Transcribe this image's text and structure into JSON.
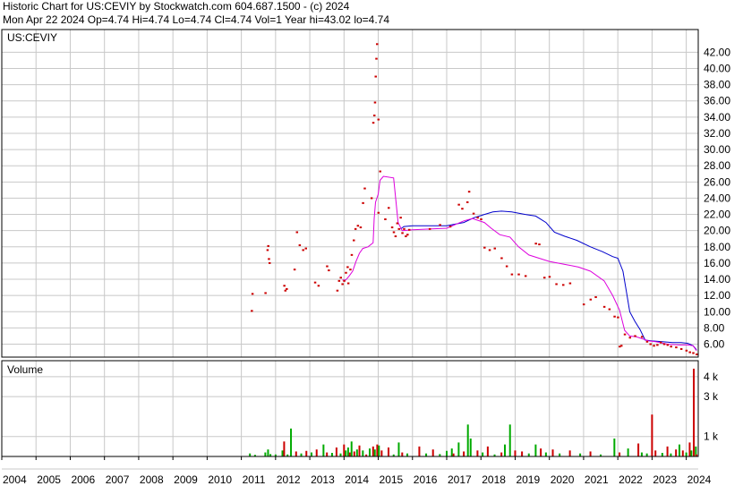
{
  "header": {
    "line1": "Historic Chart for US:CEVIY by Stockwatch.com 604.687.1500 - (c) 2024",
    "line2": "Mon Apr 22 2024  Op=4.74  Hi=4.74  Lo=4.74  Cl=4.74  Vol=1  Year hi=43.02  lo=4.74"
  },
  "price_panel": {
    "label": "US:CEVIY"
  },
  "volume_panel": {
    "label": "Volume"
  },
  "chart_data": [
    {
      "type": "scatter",
      "title": "US:CEVIY",
      "y_ticks": [
        "42.00",
        "40.00",
        "38.00",
        "36.00",
        "34.00",
        "32.00",
        "30.00",
        "28.00",
        "26.00",
        "24.00",
        "22.00",
        "20.00",
        "18.00",
        "16.00",
        "14.00",
        "12.00",
        "10.00",
        "8.00",
        "6.00"
      ],
      "ylim": [
        4.4,
        44.8
      ],
      "xlim": [
        2004.0,
        2024.35
      ],
      "x_ticks": [
        "2004",
        "2005",
        "2006",
        "2007",
        "2008",
        "2009",
        "2010",
        "2011",
        "2012",
        "2013",
        "2014",
        "2015",
        "2016",
        "2017",
        "2018",
        "2019",
        "2020",
        "2021",
        "2022",
        "2023",
        "2024"
      ],
      "grid": true,
      "colors": {
        "price": "#cc0000",
        "ma_short": "#dd00dd",
        "ma_long": "#0000cc",
        "grid": "#c8c8c8"
      },
      "price_points": [
        [
          2011.3,
          10.1
        ],
        [
          2011.32,
          12.2
        ],
        [
          2011.7,
          12.3
        ],
        [
          2011.76,
          17.6
        ],
        [
          2011.78,
          18.1
        ],
        [
          2011.8,
          16.5
        ],
        [
          2011.82,
          16.0
        ],
        [
          2012.25,
          13.2
        ],
        [
          2012.28,
          12.6
        ],
        [
          2012.32,
          12.8
        ],
        [
          2012.55,
          15.2
        ],
        [
          2012.62,
          19.8
        ],
        [
          2012.7,
          18.2
        ],
        [
          2012.8,
          17.6
        ],
        [
          2012.88,
          17.8
        ],
        [
          2013.15,
          13.6
        ],
        [
          2013.25,
          13.2
        ],
        [
          2013.5,
          15.6
        ],
        [
          2013.55,
          15.1
        ],
        [
          2013.8,
          12.6
        ],
        [
          2013.85,
          13.8
        ],
        [
          2013.9,
          14.2
        ],
        [
          2013.95,
          13.4
        ],
        [
          2014.0,
          13.8
        ],
        [
          2014.05,
          14.8
        ],
        [
          2014.1,
          15.5
        ],
        [
          2014.12,
          13.5
        ],
        [
          2014.18,
          15.2
        ],
        [
          2014.22,
          17.0
        ],
        [
          2014.28,
          18.8
        ],
        [
          2014.33,
          20.2
        ],
        [
          2014.4,
          20.6
        ],
        [
          2014.48,
          20.4
        ],
        [
          2014.55,
          23.4
        ],
        [
          2014.6,
          25.2
        ],
        [
          2014.8,
          24.0
        ],
        [
          2014.85,
          33.3
        ],
        [
          2014.88,
          34.2
        ],
        [
          2014.9,
          35.8
        ],
        [
          2014.92,
          39.0
        ],
        [
          2014.94,
          41.2
        ],
        [
          2014.96,
          43.0
        ],
        [
          2015.0,
          33.7
        ],
        [
          2015.05,
          27.3
        ],
        [
          2015.0,
          22.2
        ],
        [
          2015.2,
          21.4
        ],
        [
          2015.3,
          22.8
        ],
        [
          2015.4,
          20.4
        ],
        [
          2015.45,
          19.8
        ],
        [
          2015.5,
          19.3
        ],
        [
          2015.55,
          20.9
        ],
        [
          2015.6,
          20.2
        ],
        [
          2015.65,
          21.6
        ],
        [
          2015.7,
          19.7
        ],
        [
          2015.75,
          20.2
        ],
        [
          2015.8,
          19.3
        ],
        [
          2015.85,
          19.5
        ],
        [
          2015.9,
          20.1
        ],
        [
          2016.5,
          20.2
        ],
        [
          2016.8,
          20.7
        ],
        [
          2017.1,
          20.5
        ],
        [
          2017.35,
          23.2
        ],
        [
          2017.45,
          22.7
        ],
        [
          2017.6,
          23.5
        ],
        [
          2017.65,
          24.8
        ],
        [
          2017.78,
          22.1
        ],
        [
          2017.9,
          21.6
        ],
        [
          2018.0,
          21.4
        ],
        [
          2018.1,
          17.9
        ],
        [
          2018.25,
          17.6
        ],
        [
          2018.4,
          17.8
        ],
        [
          2018.6,
          16.6
        ],
        [
          2018.75,
          15.6
        ],
        [
          2018.9,
          14.6
        ],
        [
          2019.1,
          14.6
        ],
        [
          2019.3,
          14.4
        ],
        [
          2019.6,
          18.4
        ],
        [
          2019.7,
          18.3
        ],
        [
          2019.85,
          14.2
        ],
        [
          2020.0,
          14.3
        ],
        [
          2020.2,
          13.4
        ],
        [
          2020.4,
          13.3
        ],
        [
          2020.6,
          13.5
        ],
        [
          2021.0,
          10.9
        ],
        [
          2021.2,
          11.5
        ],
        [
          2021.35,
          11.8
        ],
        [
          2021.6,
          10.6
        ],
        [
          2021.75,
          10.3
        ],
        [
          2021.9,
          9.4
        ],
        [
          2022.0,
          9.3
        ],
        [
          2022.05,
          5.7
        ],
        [
          2022.1,
          5.8
        ],
        [
          2022.2,
          7.2
        ],
        [
          2022.35,
          6.8
        ],
        [
          2022.5,
          7.0
        ],
        [
          2022.7,
          6.9
        ],
        [
          2022.85,
          6.3
        ],
        [
          2022.95,
          6.0
        ],
        [
          2023.05,
          5.8
        ],
        [
          2023.15,
          5.9
        ],
        [
          2023.25,
          6.2
        ],
        [
          2023.35,
          6.0
        ],
        [
          2023.45,
          5.9
        ],
        [
          2023.55,
          5.7
        ],
        [
          2023.7,
          5.6
        ],
        [
          2023.85,
          5.4
        ],
        [
          2024.0,
          5.2
        ],
        [
          2024.1,
          5.0
        ],
        [
          2024.2,
          4.9
        ],
        [
          2024.3,
          4.74
        ]
      ],
      "ma_short": [
        [
          2013.95,
          13.9
        ],
        [
          2014.05,
          13.9
        ],
        [
          2014.15,
          14.4
        ],
        [
          2014.25,
          15.0
        ],
        [
          2014.35,
          16.2
        ],
        [
          2014.45,
          17.2
        ],
        [
          2014.55,
          17.8
        ],
        [
          2014.7,
          18.0
        ],
        [
          2014.85,
          18.5
        ],
        [
          2014.88,
          21.5
        ],
        [
          2014.92,
          23.5
        ],
        [
          2015.0,
          24.5
        ],
        [
          2015.05,
          26.2
        ],
        [
          2015.15,
          26.7
        ],
        [
          2015.45,
          26.5
        ],
        [
          2015.58,
          21.0
        ],
        [
          2015.7,
          20.0
        ],
        [
          2016.0,
          20.1
        ],
        [
          2016.5,
          20.2
        ],
        [
          2017.0,
          20.3
        ],
        [
          2017.5,
          21.2
        ],
        [
          2017.75,
          21.5
        ],
        [
          2018.1,
          21.0
        ],
        [
          2018.3,
          20.3
        ],
        [
          2018.55,
          19.5
        ],
        [
          2018.85,
          19.2
        ],
        [
          2019.1,
          18.0
        ],
        [
          2019.4,
          17.0
        ],
        [
          2019.7,
          16.6
        ],
        [
          2020.0,
          16.2
        ],
        [
          2020.5,
          15.8
        ],
        [
          2020.85,
          15.5
        ],
        [
          2021.2,
          15.0
        ],
        [
          2021.6,
          13.8
        ],
        [
          2021.85,
          12.0
        ],
        [
          2022.05,
          10.2
        ],
        [
          2022.2,
          7.7
        ],
        [
          2022.35,
          7.0
        ],
        [
          2022.55,
          6.9
        ],
        [
          2022.9,
          6.4
        ],
        [
          2023.1,
          6.3
        ],
        [
          2023.45,
          6.0
        ],
        [
          2023.8,
          5.9
        ],
        [
          2024.05,
          5.9
        ],
        [
          2024.2,
          5.8
        ],
        [
          2024.3,
          5.2
        ]
      ],
      "ma_long": [
        [
          2015.65,
          20.2
        ],
        [
          2015.75,
          20.5
        ],
        [
          2016.0,
          20.6
        ],
        [
          2016.5,
          20.6
        ],
        [
          2017.0,
          20.6
        ],
        [
          2017.5,
          21.0
        ],
        [
          2017.8,
          21.6
        ],
        [
          2018.1,
          22.0
        ],
        [
          2018.35,
          22.3
        ],
        [
          2018.6,
          22.4
        ],
        [
          2018.9,
          22.3
        ],
        [
          2019.3,
          22.0
        ],
        [
          2019.6,
          21.8
        ],
        [
          2019.9,
          21.0
        ],
        [
          2020.15,
          19.8
        ],
        [
          2020.45,
          19.3
        ],
        [
          2020.8,
          18.8
        ],
        [
          2021.2,
          18.0
        ],
        [
          2021.55,
          17.4
        ],
        [
          2021.85,
          16.8
        ],
        [
          2022.0,
          16.6
        ],
        [
          2022.15,
          15.0
        ],
        [
          2022.25,
          12.5
        ],
        [
          2022.35,
          10.0
        ],
        [
          2022.5,
          8.8
        ],
        [
          2022.65,
          7.8
        ],
        [
          2022.8,
          6.5
        ],
        [
          2023.0,
          6.4
        ],
        [
          2023.3,
          6.3
        ],
        [
          2023.6,
          6.2
        ],
        [
          2023.85,
          6.2
        ],
        [
          2024.05,
          6.1
        ],
        [
          2024.2,
          5.8
        ],
        [
          2024.3,
          5.3
        ]
      ]
    },
    {
      "type": "bar",
      "title": "Volume",
      "y_ticks": [
        "4 k",
        "3 k",
        "1 k"
      ],
      "ylim": [
        0,
        4800
      ],
      "xlim": [
        2004.0,
        2024.35
      ],
      "colors": {
        "up": "#00aa00",
        "down": "#cc0000"
      },
      "bars": [
        [
          2011.25,
          150,
          "up"
        ],
        [
          2011.4,
          80,
          "up"
        ],
        [
          2011.7,
          200,
          "up"
        ],
        [
          2011.78,
          350,
          "up"
        ],
        [
          2011.85,
          120,
          "up"
        ],
        [
          2012.0,
          100,
          "up"
        ],
        [
          2012.2,
          300,
          "up"
        ],
        [
          2012.25,
          750,
          "down"
        ],
        [
          2012.35,
          100,
          "up"
        ],
        [
          2012.45,
          1400,
          "up"
        ],
        [
          2012.6,
          250,
          "down"
        ],
        [
          2012.75,
          150,
          "up"
        ],
        [
          2012.9,
          280,
          "down"
        ],
        [
          2013.05,
          200,
          "up"
        ],
        [
          2013.2,
          350,
          "down"
        ],
        [
          2013.4,
          600,
          "up"
        ],
        [
          2013.5,
          200,
          "down"
        ],
        [
          2013.65,
          180,
          "up"
        ],
        [
          2013.78,
          450,
          "down"
        ],
        [
          2013.9,
          150,
          "up"
        ],
        [
          2014.0,
          600,
          "down"
        ],
        [
          2014.05,
          300,
          "up"
        ],
        [
          2014.12,
          450,
          "up"
        ],
        [
          2014.17,
          200,
          "down"
        ],
        [
          2014.22,
          750,
          "up"
        ],
        [
          2014.3,
          250,
          "down"
        ],
        [
          2014.38,
          350,
          "up"
        ],
        [
          2014.45,
          550,
          "down"
        ],
        [
          2014.55,
          300,
          "up"
        ],
        [
          2014.65,
          100,
          "down"
        ],
        [
          2014.75,
          400,
          "up"
        ],
        [
          2014.85,
          500,
          "down"
        ],
        [
          2014.9,
          350,
          "up"
        ],
        [
          2014.97,
          600,
          "down"
        ],
        [
          2015.02,
          550,
          "up"
        ],
        [
          2015.1,
          300,
          "down"
        ],
        [
          2015.3,
          450,
          "down"
        ],
        [
          2015.45,
          100,
          "up"
        ],
        [
          2015.6,
          700,
          "up"
        ],
        [
          2015.7,
          200,
          "down"
        ],
        [
          2015.85,
          150,
          "up"
        ],
        [
          2016.2,
          500,
          "down"
        ],
        [
          2016.4,
          150,
          "up"
        ],
        [
          2016.6,
          350,
          "down"
        ],
        [
          2016.8,
          120,
          "up"
        ],
        [
          2017.0,
          280,
          "up"
        ],
        [
          2017.15,
          400,
          "up"
        ],
        [
          2017.2,
          150,
          "down"
        ],
        [
          2017.35,
          700,
          "up"
        ],
        [
          2017.5,
          250,
          "down"
        ],
        [
          2017.62,
          1600,
          "up"
        ],
        [
          2017.7,
          900,
          "up"
        ],
        [
          2017.9,
          300,
          "down"
        ],
        [
          2018.05,
          200,
          "up"
        ],
        [
          2018.2,
          500,
          "down"
        ],
        [
          2018.4,
          100,
          "up"
        ],
        [
          2018.6,
          200,
          "down"
        ],
        [
          2018.7,
          600,
          "up"
        ],
        [
          2018.85,
          1600,
          "up"
        ],
        [
          2019.0,
          300,
          "down"
        ],
        [
          2019.2,
          250,
          "down"
        ],
        [
          2019.4,
          150,
          "up"
        ],
        [
          2019.6,
          600,
          "up"
        ],
        [
          2019.75,
          400,
          "down"
        ],
        [
          2019.9,
          200,
          "up"
        ],
        [
          2020.1,
          350,
          "down"
        ],
        [
          2020.3,
          150,
          "up"
        ],
        [
          2020.6,
          300,
          "down"
        ],
        [
          2020.9,
          150,
          "up"
        ],
        [
          2021.2,
          250,
          "down"
        ],
        [
          2021.5,
          100,
          "up"
        ],
        [
          2021.9,
          900,
          "up"
        ],
        [
          2022.05,
          200,
          "down"
        ],
        [
          2022.3,
          400,
          "up"
        ],
        [
          2022.6,
          650,
          "down"
        ],
        [
          2022.7,
          200,
          "up"
        ],
        [
          2022.85,
          150,
          "up"
        ],
        [
          2023.0,
          2100,
          "down"
        ],
        [
          2023.1,
          300,
          "down"
        ],
        [
          2023.3,
          180,
          "up"
        ],
        [
          2023.45,
          500,
          "down"
        ],
        [
          2023.55,
          150,
          "up"
        ],
        [
          2023.7,
          350,
          "down"
        ],
        [
          2023.8,
          600,
          "up"
        ],
        [
          2023.9,
          300,
          "down"
        ],
        [
          2024.0,
          200,
          "up"
        ],
        [
          2024.1,
          700,
          "down"
        ],
        [
          2024.15,
          300,
          "up"
        ],
        [
          2024.22,
          4400,
          "down"
        ],
        [
          2024.28,
          500,
          "up"
        ],
        [
          2024.3,
          100,
          "down"
        ]
      ]
    }
  ]
}
